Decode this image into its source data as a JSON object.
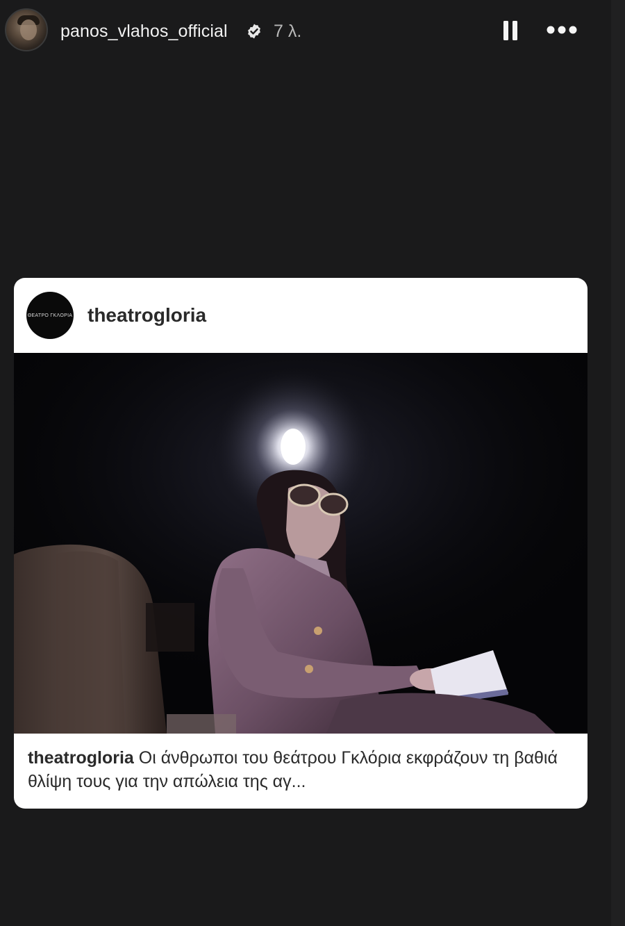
{
  "header": {
    "username": "panos_vlahos_official",
    "time_ago": "7 λ.",
    "verified_icon": "verified-badge-icon",
    "pause_icon": "pause-icon",
    "more_icon": "more-horizontal-icon"
  },
  "shared_post": {
    "account": "theatrogloria",
    "avatar_text": "ΘΕΑΤΡΟ ΓΚΛΟΡΙΑ",
    "caption_user": "theatrogloria",
    "caption_text": "Οι άνθρωποι του θεάτρου Γκλόρια εκφράζουν τη βαθιά θλίψη τους για την απώλεια της αγ..."
  },
  "colors": {
    "background": "#1a1a1b",
    "card": "#ffffff",
    "text_light": "#f2f2f2",
    "text_dark": "#2a2a2a"
  }
}
